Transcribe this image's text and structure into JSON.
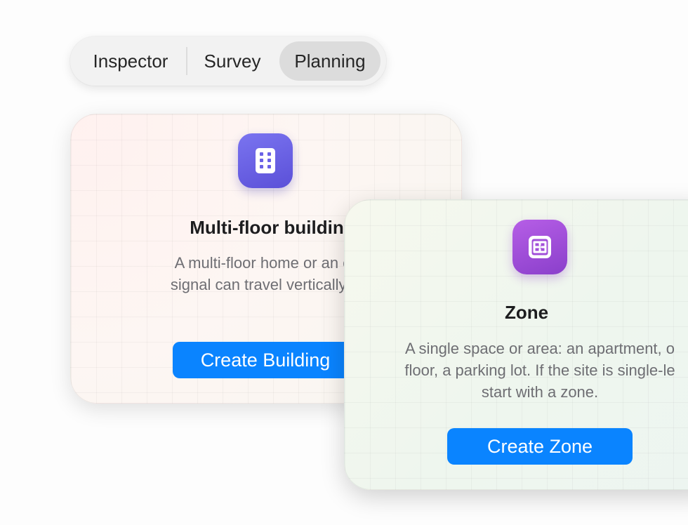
{
  "segmented_control": {
    "tabs": [
      {
        "label": "Inspector",
        "selected": false
      },
      {
        "label": "Survey",
        "selected": false
      },
      {
        "label": "Planning",
        "selected": true
      }
    ]
  },
  "building_card": {
    "icon": "building-grid-icon",
    "title": "Multi-floor buildin",
    "description_lines": [
      "A multi-floor home or an office",
      "signal can travel vertically betw"
    ],
    "button_label": "Create Building",
    "icon_color": "#6a62e6"
  },
  "zone_card": {
    "icon": "zone-floorplan-icon",
    "title": "Zone",
    "description_lines": [
      "A single space or area: an apartment, o",
      "floor, a parking lot. If the site is single-le",
      "start with a zone."
    ],
    "button_label": "Create Zone",
    "icon_color": "#a24fd9"
  },
  "colors": {
    "accent": "#0a84ff"
  }
}
